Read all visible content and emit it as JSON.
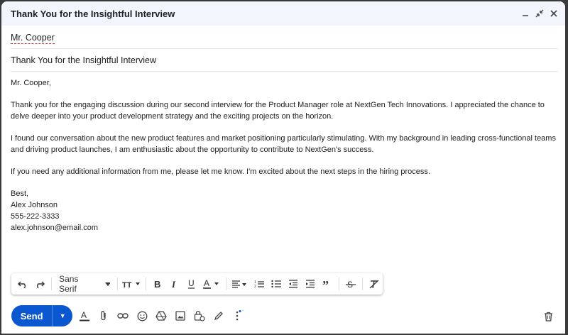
{
  "window": {
    "title": "Thank You for the Insightful Interview"
  },
  "recipients": {
    "to": "Mr. Cooper"
  },
  "subject": "Thank You for the Insightful Interview",
  "body": {
    "greeting": "Mr. Cooper,",
    "p1": "Thank you for the engaging discussion during our second interview for the Product Manager role at NextGen Tech Innovations. I appreciated the chance to delve deeper into your product development strategy and the exciting projects on the horizon.",
    "p2": "I found our conversation about the new product features and market positioning particularly stimulating. With my background in leading cross-functional teams and driving product launches, I am enthusiastic about the opportunity to contribute to NextGen's success.",
    "p3": "If you need any additional information from me, please let me know. I'm excited about the next steps in the hiring process.",
    "closing": "Best,",
    "name": "Alex Johnson",
    "phone": "555-222-3333",
    "email": "alex.johnson@email.com"
  },
  "toolbar": {
    "font": "Sans Serif"
  },
  "actions": {
    "send_label": "Send"
  },
  "colors": {
    "send": "#0b57d0",
    "titlebar": "#f2f6fc"
  }
}
